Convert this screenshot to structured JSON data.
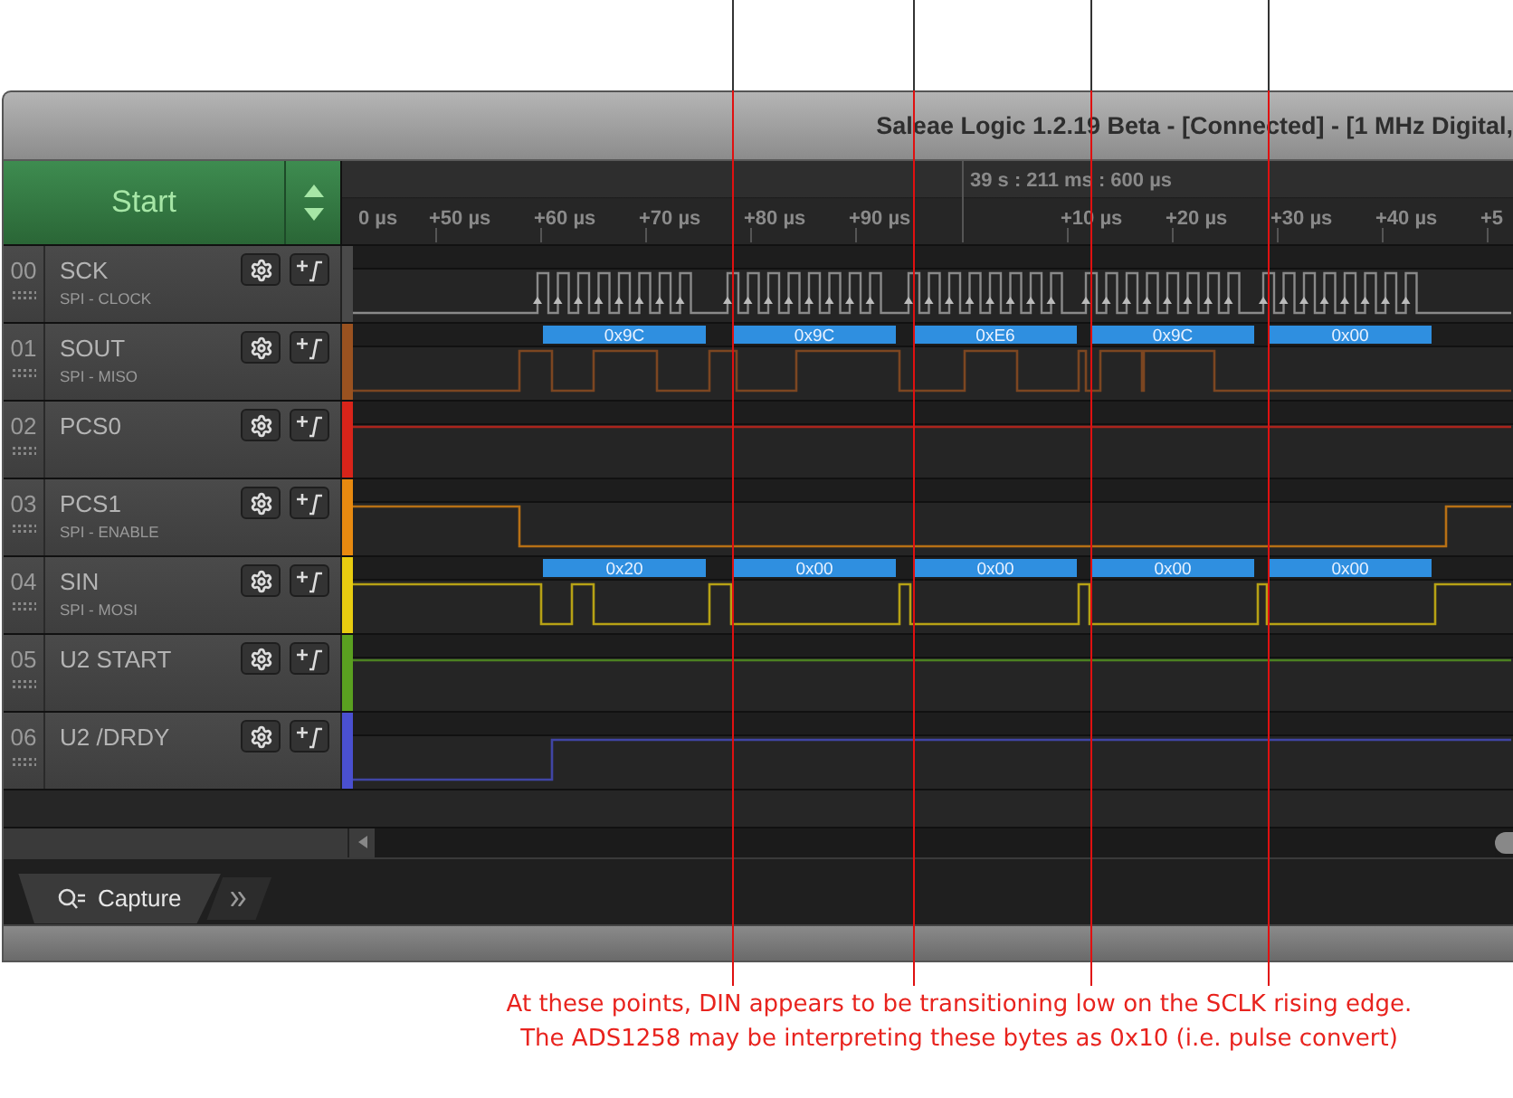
{
  "window": {
    "title": "Saleae Logic 1.2.19 Beta - [Connected] - [1 MHz Digital,"
  },
  "start_button": {
    "label": "Start"
  },
  "timeline": {
    "timestamp": "39 s : 211 ms : 600 µs",
    "ticks": [
      "0 µs",
      "+50 µs",
      "+60 µs",
      "+70 µs",
      "+80 µs",
      "+90 µs",
      "+10 µs",
      "+20 µs",
      "+30 µs",
      "+40 µs",
      "+5"
    ]
  },
  "channels": [
    {
      "number": "00",
      "name": "SCK",
      "protocol": "SPI - CLOCK",
      "color": "#4a4a4a",
      "kind": "clock"
    },
    {
      "number": "01",
      "name": "SOUT",
      "protocol": "SPI - MISO",
      "color": "#9a5220",
      "kind": "digital",
      "decoded": [
        "0x9C",
        "0x9C",
        "0xE6",
        "0x9C",
        "0x00"
      ]
    },
    {
      "number": "02",
      "name": "PCS0",
      "color": "#d8241a",
      "kind": "digital"
    },
    {
      "number": "03",
      "name": "PCS1",
      "protocol": "SPI - ENABLE",
      "color": "#e88a10",
      "kind": "digital"
    },
    {
      "number": "04",
      "name": "SIN",
      "protocol": "SPI - MOSI",
      "color": "#e8cc10",
      "kind": "digital",
      "decoded": [
        "0x20",
        "0x00",
        "0x00",
        "0x00",
        "0x00"
      ]
    },
    {
      "number": "05",
      "name": "U2 START",
      "color": "#5aa020",
      "kind": "digital"
    },
    {
      "number": "06",
      "name": "U2 /DRDY",
      "color": "#4a50d0",
      "kind": "digital"
    }
  ],
  "tabs": [
    {
      "label": "Capture",
      "selected": true
    }
  ],
  "annotation": [
    "At these points, DIN appears to be transitioning low on the SCLK rising edge.",
    "The ADS1258 may be interpreting these bytes as 0x10 (i.e. pulse convert)"
  ]
}
